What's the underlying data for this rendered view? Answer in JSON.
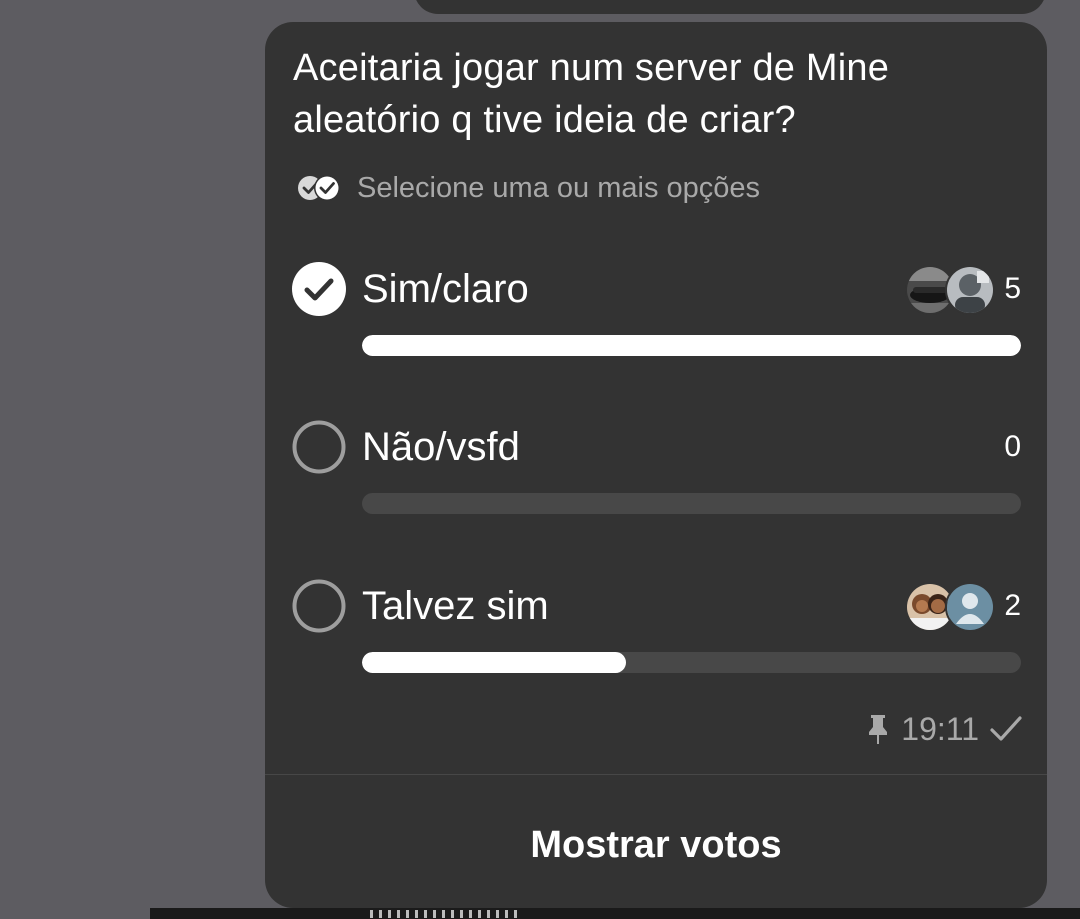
{
  "poll": {
    "question": "Aceitaria jogar num server de Mine aleatório q tive ideia de criar?",
    "hint": "Selecione uma ou mais opções",
    "hint_icon": "double-check-icon",
    "options": [
      {
        "label": "Sim/claro",
        "count": "5",
        "selected": true,
        "share": 1.0,
        "voter_avatars": [
          "avatar-car-photo",
          "avatar-grey-photo"
        ]
      },
      {
        "label": "Não/vsfd",
        "count": "0",
        "selected": false,
        "share": 0.0,
        "voter_avatars": []
      },
      {
        "label": "Talvez sim",
        "count": "2",
        "selected": false,
        "share": 0.4,
        "voter_avatars": [
          "avatar-couple-photo",
          "avatar-default-person"
        ]
      }
    ],
    "time": "19:11",
    "status_icons": [
      "pin-icon",
      "check-icon"
    ],
    "show_votes_label": "Mostrar votos"
  },
  "colors": {
    "chat_background": "#5d5c61",
    "bubble": "#333333",
    "text_primary": "#ffffff",
    "text_secondary": "#a9a9a9",
    "bar_track": "#484848",
    "bar_fill": "#ffffff",
    "radio_ring": "#9e9e9e"
  }
}
